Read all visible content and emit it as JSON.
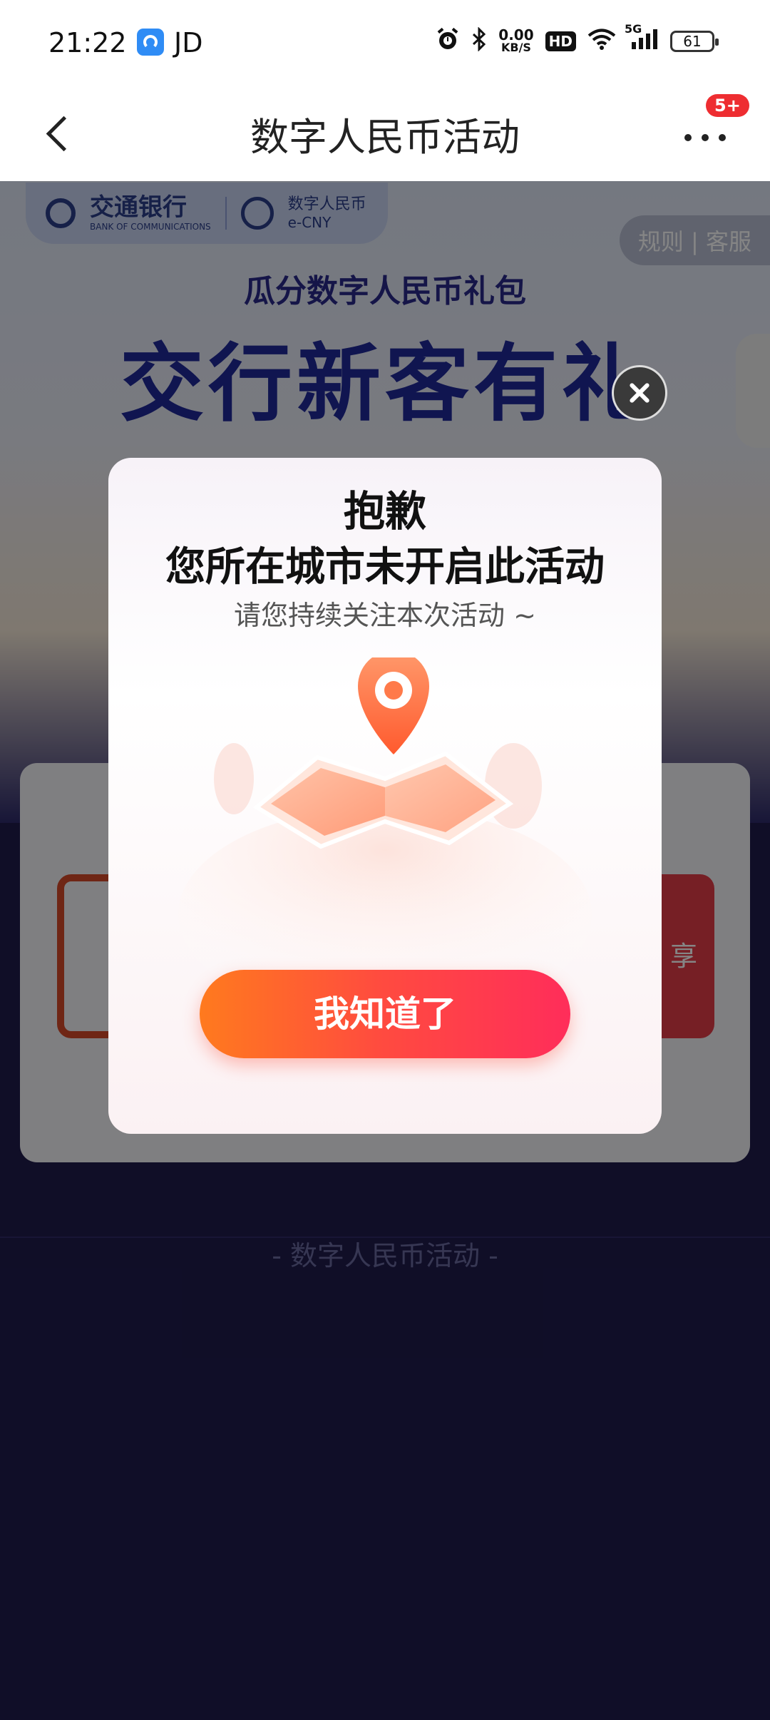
{
  "status": {
    "time": "21:22",
    "app_label": "JD",
    "net_speed_value": "0.00",
    "net_speed_unit": "KB/S",
    "hd_label": "HD",
    "signal_label": "5G",
    "battery": "61"
  },
  "header": {
    "title": "数字人民币活动",
    "badge": "5+"
  },
  "background": {
    "bank_logo_name": "交通银行",
    "bank_logo_en": "BANK OF COMMUNICATIONS",
    "ecny_logo": "数字人民币",
    "ecny_logo_en": "e-CNY",
    "rules_label": "规则 | 客服",
    "hero_subtitle": "瓜分数字人民币礼包",
    "hero_title": "交行新客有礼",
    "card_right_text": "享",
    "footer_note": "- 数字人民币活动 -"
  },
  "modal": {
    "title_line1": "抱歉",
    "title_line2": "您所在城市未开启此活动",
    "subtitle": "请您持续关注本次活动 ~",
    "ok_button": "我知道了"
  },
  "colors": {
    "accent_gradient_start": "#ff7a1e",
    "accent_gradient_end": "#ff2d5a",
    "page_bg": "#1f1b4c",
    "badge_red": "#ee2d31"
  }
}
